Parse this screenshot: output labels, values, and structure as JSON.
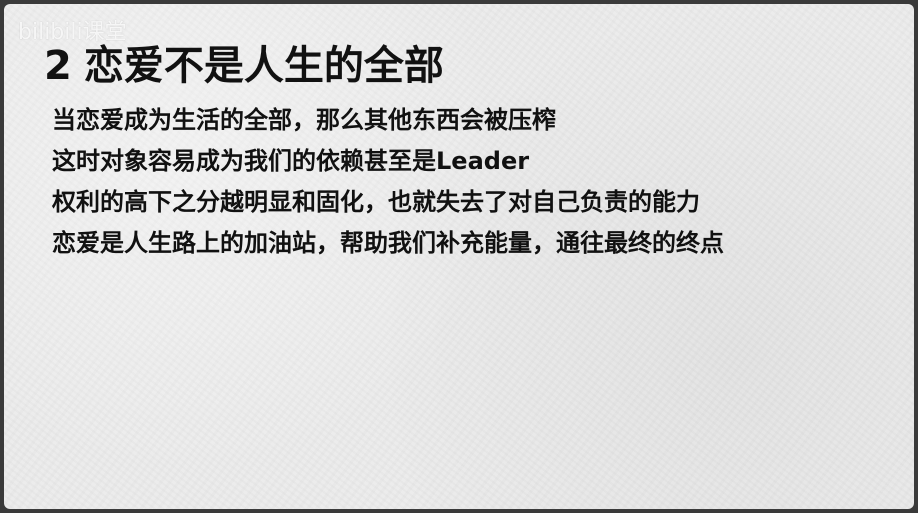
{
  "watermark": "bilibili课堂",
  "heading": {
    "number": "2",
    "text": "恋爱不是人生的全部"
  },
  "lines": [
    "当恋爱成为生活的全部，那么其他东西会被压榨",
    "这时对象容易成为我们的依赖甚至是Leader",
    "权利的高下之分越明显和固化，也就失去了对自己负责的能力",
    "恋爱是人生路上的加油站，帮助我们补充能量，通往最终的终点"
  ]
}
